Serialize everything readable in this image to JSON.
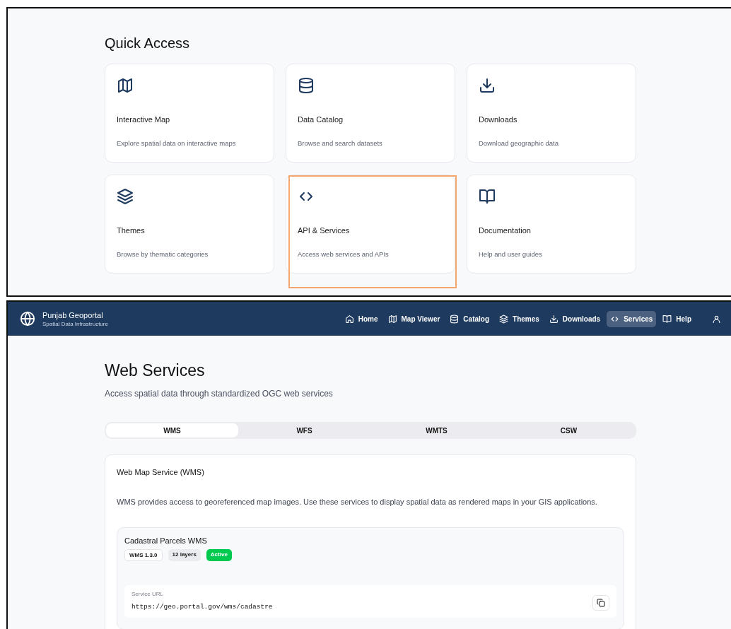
{
  "quick_access": {
    "title": "Quick Access",
    "cards": [
      {
        "title": "Interactive Map",
        "description": "Explore spatial data on interactive maps",
        "highlighted": false
      },
      {
        "title": "Data Catalog",
        "description": "Browse and search datasets",
        "highlighted": false
      },
      {
        "title": "Downloads",
        "description": "Download geographic data",
        "highlighted": false
      },
      {
        "title": "Themes",
        "description": "Browse by thematic categories",
        "highlighted": false
      },
      {
        "title": "API & Services",
        "description": "Access web services and APIs",
        "highlighted": true
      },
      {
        "title": "Documentation",
        "description": "Help and user guides",
        "highlighted": false
      }
    ]
  },
  "header": {
    "title": "Punjab Geoportal",
    "subtitle": "Spatial Data Infrastructure",
    "nav": [
      {
        "label": "Home",
        "selected": false
      },
      {
        "label": "Map Viewer",
        "selected": false
      },
      {
        "label": "Catalog",
        "selected": false
      },
      {
        "label": "Themes",
        "selected": false
      },
      {
        "label": "Downloads",
        "selected": false
      },
      {
        "label": "Services",
        "selected": true
      },
      {
        "label": "Help",
        "selected": false
      }
    ]
  },
  "page": {
    "title": "Web Services",
    "subtitle": "Access spatial data through standardized OGC web services"
  },
  "tabs": [
    {
      "label": "WMS",
      "selected": true
    },
    {
      "label": "WFS",
      "selected": false
    },
    {
      "label": "WMTS",
      "selected": false
    },
    {
      "label": "CSW",
      "selected": false
    }
  ],
  "panel": {
    "title": "Web Map Service (WMS)",
    "description": "WMS provides access to georeferenced map images. Use these services to display spatial data as rendered maps in your GIS applications."
  },
  "services": [
    {
      "name": "Cadastral Parcels WMS",
      "badges": [
        {
          "text": "WMS 1.3.0",
          "kind": "outline"
        },
        {
          "text": "12 layers",
          "kind": "muted"
        },
        {
          "text": "Active",
          "kind": "status"
        }
      ],
      "url_label": "Service URL",
      "url": "https://geo.portal.gov/wms/cadastre"
    }
  ]
}
